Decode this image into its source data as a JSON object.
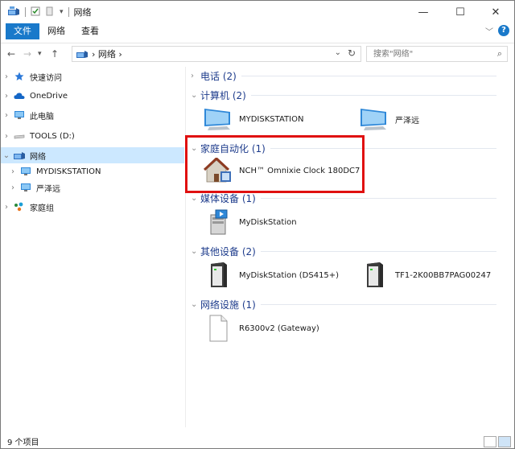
{
  "window": {
    "title": "网络",
    "minimize": "—",
    "maximize": "☐",
    "close": "✕"
  },
  "ribbon": {
    "file": "文件",
    "tabs": [
      "网络",
      "查看"
    ],
    "help": "?"
  },
  "address": {
    "breadcrumb": "› 网络 ›",
    "search_placeholder": "搜索\"网络\""
  },
  "nav": {
    "items": [
      {
        "label": "快速访问",
        "icon": "star-icon"
      },
      {
        "label": "OneDrive",
        "icon": "cloud-icon"
      },
      {
        "label": "此电脑",
        "icon": "computer-icon"
      },
      {
        "label": "TOOLS (D:)",
        "icon": "drive-icon"
      },
      {
        "label": "网络",
        "icon": "network-icon",
        "selected": true
      },
      {
        "label": "MYDISKSTATION",
        "icon": "computer-icon"
      },
      {
        "label": "严泽远",
        "icon": "computer-icon"
      },
      {
        "label": "家庭组",
        "icon": "homegroup-icon"
      }
    ]
  },
  "groups": [
    {
      "name": "电话 (2)",
      "expanded": false
    },
    {
      "name": "计算机 (2)",
      "expanded": true,
      "items": [
        "MYDISKSTATION",
        "严泽远"
      ]
    },
    {
      "name": "家庭自动化 (1)",
      "expanded": true,
      "items": [
        "NCH™ Omnixie Clock 180DC7"
      ]
    },
    {
      "name": "媒体设备 (1)",
      "expanded": true,
      "items": [
        "MyDiskStation"
      ]
    },
    {
      "name": "其他设备 (2)",
      "expanded": true,
      "items": [
        "MyDiskStation (DS415+)",
        "TF1-2K00BB7PAG00247"
      ]
    },
    {
      "name": "网络设施 (1)",
      "expanded": true,
      "items": [
        "R6300v2 (Gateway)"
      ]
    }
  ],
  "status": {
    "count": "9 个项目"
  },
  "colors": {
    "accent": "#1979ca",
    "group_text": "#1e3c8c",
    "selection": "#cce8ff",
    "highlight": "#e01010"
  }
}
